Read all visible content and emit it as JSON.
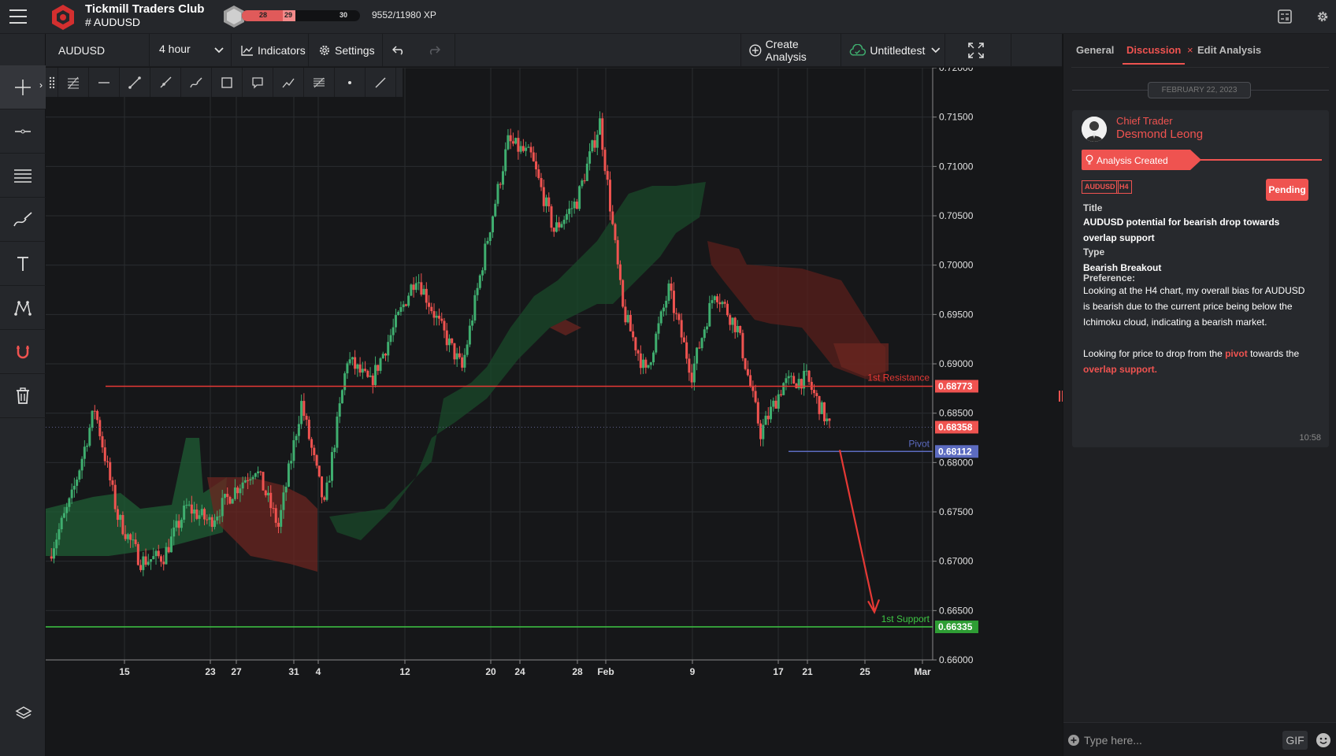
{
  "header": {
    "brand": "Tickmill Traders Club",
    "channel": "# AUDUSD",
    "level_current": "28",
    "level_mid": "29",
    "level_next": "30",
    "xp": "9552/11980 XP",
    "xp_progress": 0.797
  },
  "chart_toolbar": {
    "symbol": "AUDUSD",
    "timeframe": "4 hour",
    "indicators_label": "Indicators",
    "settings_label": "Settings",
    "create_analysis_label": "Create Analysis",
    "workspace_label": "Untitledtest"
  },
  "left_tools": [
    "crosshair-icon",
    "horizontal-line-icon",
    "fib-levels-icon",
    "pen-brush-icon",
    "text-icon",
    "pattern-icon",
    "magnet-icon",
    "trash-icon",
    "layers-icon"
  ],
  "draw_tools": [
    "grip-icon",
    "fib-retracement-icon",
    "horizontal-ray-icon",
    "trend-line-icon",
    "ray-icon",
    "brush-icon",
    "rectangle-icon",
    "callout-icon",
    "path-icon",
    "parallel-channel-icon",
    "dot-icon",
    "diagonal-line-icon"
  ],
  "colors": {
    "bull": "#3fae6f",
    "bear": "#ef5350",
    "resistance": "#e53935",
    "support": "#3ec744",
    "pivot": "#5c6bc0",
    "price_label": "#ef5350",
    "accent": "#ef5350"
  },
  "chart_data": {
    "type": "line",
    "title": "",
    "symbol": "AUDUSD",
    "timeframe": "4 hour",
    "xlabel": "",
    "ylabel": "",
    "x_ticks": [
      "15",
      "23",
      "27",
      "31",
      "4",
      "12",
      "20",
      "24",
      "28",
      "Feb",
      "9",
      "17",
      "21",
      "25",
      "Mar"
    ],
    "y_ticks": [
      "0.72000",
      "0.71500",
      "0.71000",
      "0.70500",
      "0.70000",
      "0.69500",
      "0.69000",
      "0.68500",
      "0.68000",
      "0.67500",
      "0.67000",
      "0.66500",
      "0.66000"
    ],
    "ylim": [
      0.66,
      0.72
    ],
    "grid": true,
    "series": [
      {
        "x": [
          "11",
          "13",
          "15",
          "17",
          "19",
          "23",
          "25",
          "27",
          "29",
          "31",
          "2",
          "4",
          "6",
          "10",
          "12",
          "14",
          "16",
          "18",
          "20",
          "22",
          "24",
          "26",
          "28",
          "30",
          "Feb",
          "3",
          "7",
          "9",
          "11",
          "13",
          "15",
          "17",
          "19",
          "21",
          "22"
        ],
        "values": [
          0.6705,
          0.6765,
          0.6855,
          0.6745,
          0.67,
          0.6705,
          0.6755,
          0.674,
          0.677,
          0.6795,
          0.6735,
          0.686,
          0.6755,
          0.6905,
          0.688,
          0.6935,
          0.699,
          0.694,
          0.6895,
          0.7015,
          0.7125,
          0.711,
          0.7035,
          0.7065,
          0.7145,
          0.6955,
          0.689,
          0.6975,
          0.689,
          0.6975,
          0.6935,
          0.683,
          0.688,
          0.6885,
          0.6836
        ]
      }
    ],
    "levels": [
      {
        "name": "1st Resistance",
        "value": 0.68773,
        "label": "0.68773"
      },
      {
        "name": "Pivot",
        "value": 0.68112,
        "label": "0.68112"
      },
      {
        "name": "1st Support",
        "value": 0.66335,
        "label": "0.66335"
      }
    ],
    "current_price": {
      "value": 0.68358,
      "label": "0.68358"
    },
    "projection": {
      "from": 0.68,
      "to": 0.665,
      "direction": "down"
    }
  },
  "right_panel": {
    "tabs": [
      {
        "label": "General"
      },
      {
        "label": "Discussion"
      },
      {
        "label": "Edit Analysis"
      }
    ],
    "date": "FEBRUARY 22, 2023",
    "post": {
      "role": "Chief Trader",
      "author": "Desmond Leong",
      "status_label": "Analysis Created",
      "tags": [
        "AUDUSD",
        "H4"
      ],
      "badge": "Pending",
      "title_label": "Title",
      "title": "AUDUSD potential for bearish drop towards overlap support",
      "type_label": "Type",
      "type": "Bearish Breakout",
      "pref_label": "Preference:",
      "pref_p1": "Looking at the H4 chart, my overall bias for AUDUSD is bearish due to the current price being below the Ichimoku cloud, indicating a bearish market.",
      "pref_p2_a": "Looking for price to drop from the ",
      "pref_p2_pivot": "pivot",
      "pref_p2_b": " towards the ",
      "pref_p2_support": "overlap support.",
      "time": "10:58"
    },
    "composer": {
      "placeholder": "Type here...",
      "gif_label": "GIF"
    }
  }
}
